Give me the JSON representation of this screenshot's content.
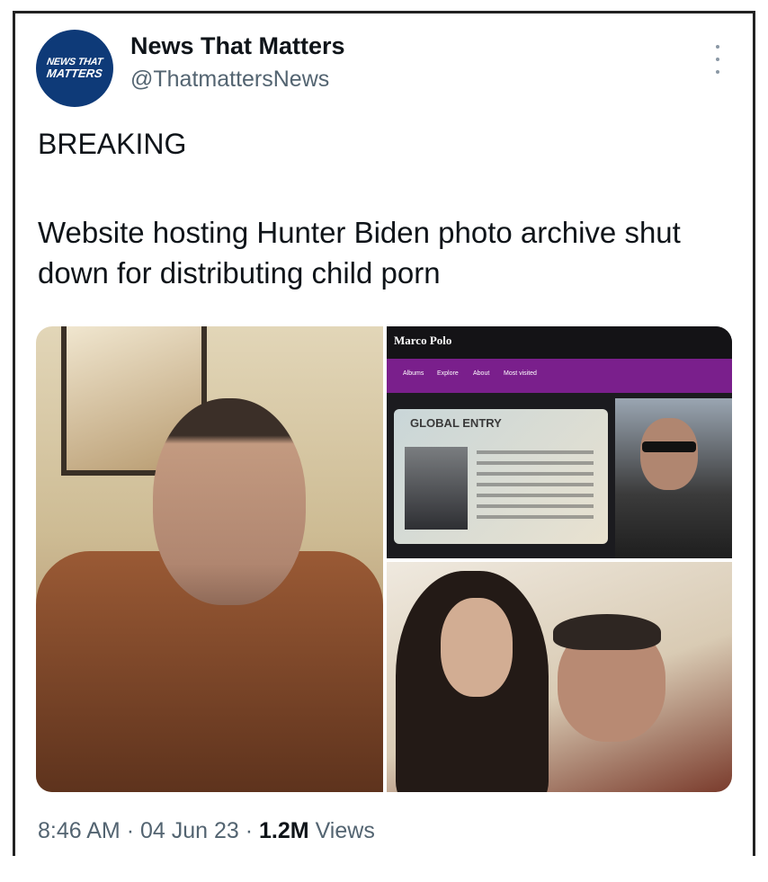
{
  "account": {
    "name": "News That Matters",
    "handle": "@ThatmattersNews",
    "avatar_text_top": "NEWS THAT",
    "avatar_text_bottom": "MATTERS"
  },
  "post": {
    "headline": "BREAKING",
    "body": "Website hosting Hunter Biden photo archive shut down for distributing child porn"
  },
  "media": {
    "site_logo": "Marco Polo",
    "site_nav": [
      "Albums",
      "Explore",
      "About",
      "Most visited"
    ],
    "card_title": "GLOBAL ENTRY"
  },
  "meta": {
    "time": "8:46 AM",
    "date": "04 Jun 23",
    "views_count": "1.2M",
    "views_label": "Views",
    "separator": "·"
  },
  "colors": {
    "text": "#0f1419",
    "secondary": "#536471",
    "avatar_bg": "#0e3a78",
    "nav_purple": "#7a1f8c"
  }
}
